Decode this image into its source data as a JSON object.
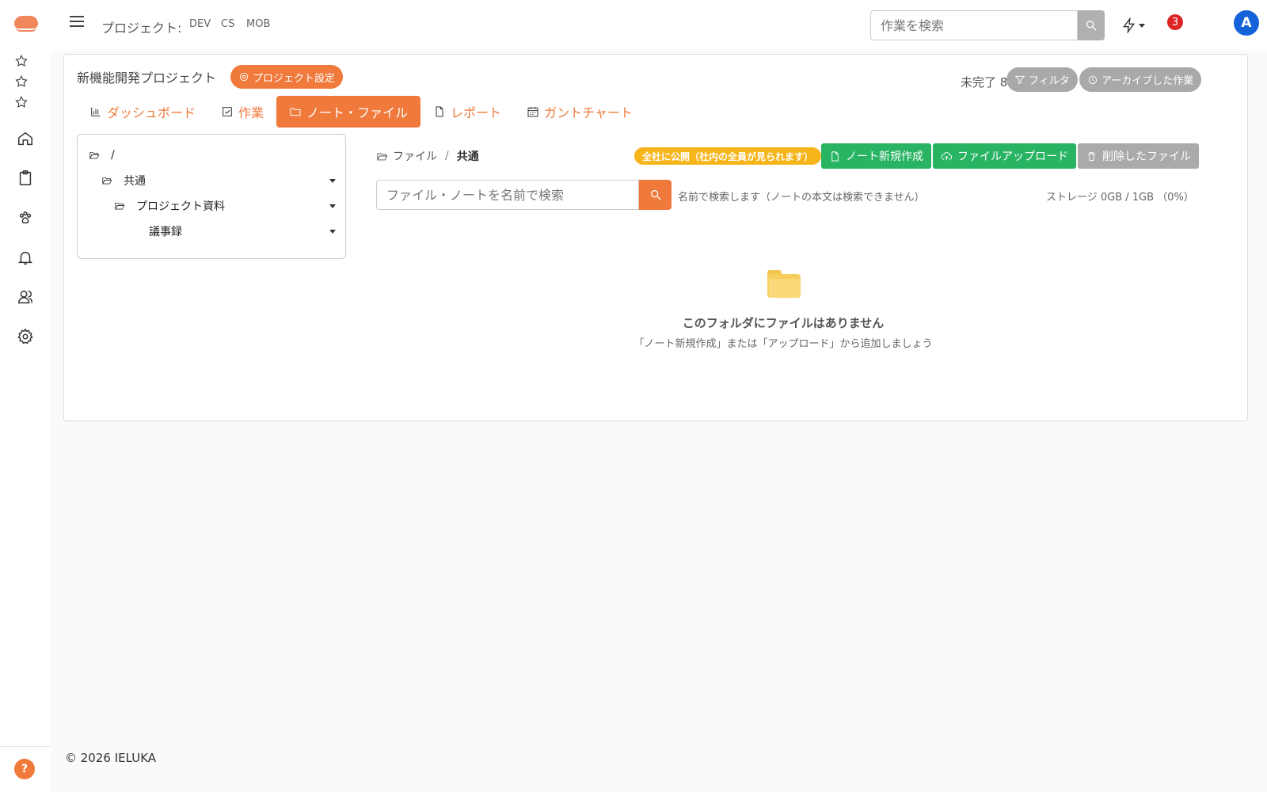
{
  "header": {
    "project_label": "プロジェクト:",
    "project_chips": [
      "DEV",
      "CS",
      "MOB"
    ],
    "search_placeholder": "作業を検索",
    "notification_count": "3",
    "avatar_initial": "A"
  },
  "project": {
    "title": "新機能開発プロジェクト",
    "settings_label": "プロジェクト設定",
    "incomplete": "未完了 8 件",
    "filter_label": "フィルタ",
    "archived_label": "アーカイブした作業"
  },
  "tabs": [
    {
      "label": "ダッシュボード",
      "icon": "chart-icon",
      "active": false
    },
    {
      "label": "作業",
      "icon": "checkbox-icon",
      "active": false
    },
    {
      "label": "ノート・ファイル",
      "icon": "folder-icon",
      "active": true
    },
    {
      "label": "レポート",
      "icon": "document-icon",
      "active": false
    },
    {
      "label": "ガントチャート",
      "icon": "calendar-icon",
      "active": false
    }
  ],
  "tree": [
    {
      "label": "/",
      "level": 0,
      "folder": true,
      "caret": false
    },
    {
      "label": "共通",
      "level": 1,
      "folder": true,
      "caret": true
    },
    {
      "label": "プロジェクト資料",
      "level": 2,
      "folder": true,
      "caret": true
    },
    {
      "label": "議事録",
      "level": 3,
      "folder": false,
      "caret": true
    }
  ],
  "files": {
    "breadcrumb_root": "ファイル",
    "breadcrumb_sep": "/",
    "breadcrumb_current": "共通",
    "public_badge": "全社に公開（社内の全員が見られます）",
    "new_note": "ノート新規作成",
    "upload": "ファイルアップロード",
    "deleted": "削除したファイル",
    "search_placeholder": "ファイル・ノートを名前で検索",
    "search_hint": "名前で検索します（ノートの本文は検索できません）",
    "storage": "ストレージ 0GB / 1GB （0%）",
    "empty_title": "このフォルダにファイルはありません",
    "empty_sub": "「ノート新規作成」または「アップロード」から追加しましょう"
  },
  "footer": "© 2026 IELUKA",
  "help": "?",
  "colors": {
    "accent": "#f07a3c",
    "green": "#28b463",
    "badge": "#f7b51c",
    "avatar": "#1463d9",
    "notif": "#dc2626"
  }
}
